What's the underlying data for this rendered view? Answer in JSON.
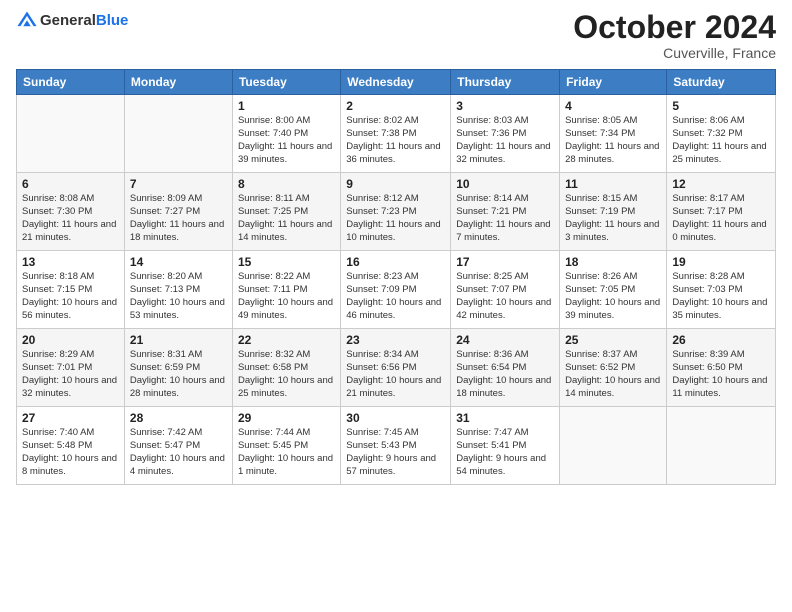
{
  "header": {
    "logo_general": "General",
    "logo_blue": "Blue",
    "month": "October 2024",
    "location": "Cuverville, France"
  },
  "columns": [
    "Sunday",
    "Monday",
    "Tuesday",
    "Wednesday",
    "Thursday",
    "Friday",
    "Saturday"
  ],
  "weeks": [
    [
      {
        "day": "",
        "sunrise": "",
        "sunset": "",
        "daylight": ""
      },
      {
        "day": "",
        "sunrise": "",
        "sunset": "",
        "daylight": ""
      },
      {
        "day": "1",
        "sunrise": "Sunrise: 8:00 AM",
        "sunset": "Sunset: 7:40 PM",
        "daylight": "Daylight: 11 hours and 39 minutes."
      },
      {
        "day": "2",
        "sunrise": "Sunrise: 8:02 AM",
        "sunset": "Sunset: 7:38 PM",
        "daylight": "Daylight: 11 hours and 36 minutes."
      },
      {
        "day": "3",
        "sunrise": "Sunrise: 8:03 AM",
        "sunset": "Sunset: 7:36 PM",
        "daylight": "Daylight: 11 hours and 32 minutes."
      },
      {
        "day": "4",
        "sunrise": "Sunrise: 8:05 AM",
        "sunset": "Sunset: 7:34 PM",
        "daylight": "Daylight: 11 hours and 28 minutes."
      },
      {
        "day": "5",
        "sunrise": "Sunrise: 8:06 AM",
        "sunset": "Sunset: 7:32 PM",
        "daylight": "Daylight: 11 hours and 25 minutes."
      }
    ],
    [
      {
        "day": "6",
        "sunrise": "Sunrise: 8:08 AM",
        "sunset": "Sunset: 7:30 PM",
        "daylight": "Daylight: 11 hours and 21 minutes."
      },
      {
        "day": "7",
        "sunrise": "Sunrise: 8:09 AM",
        "sunset": "Sunset: 7:27 PM",
        "daylight": "Daylight: 11 hours and 18 minutes."
      },
      {
        "day": "8",
        "sunrise": "Sunrise: 8:11 AM",
        "sunset": "Sunset: 7:25 PM",
        "daylight": "Daylight: 11 hours and 14 minutes."
      },
      {
        "day": "9",
        "sunrise": "Sunrise: 8:12 AM",
        "sunset": "Sunset: 7:23 PM",
        "daylight": "Daylight: 11 hours and 10 minutes."
      },
      {
        "day": "10",
        "sunrise": "Sunrise: 8:14 AM",
        "sunset": "Sunset: 7:21 PM",
        "daylight": "Daylight: 11 hours and 7 minutes."
      },
      {
        "day": "11",
        "sunrise": "Sunrise: 8:15 AM",
        "sunset": "Sunset: 7:19 PM",
        "daylight": "Daylight: 11 hours and 3 minutes."
      },
      {
        "day": "12",
        "sunrise": "Sunrise: 8:17 AM",
        "sunset": "Sunset: 7:17 PM",
        "daylight": "Daylight: 11 hours and 0 minutes."
      }
    ],
    [
      {
        "day": "13",
        "sunrise": "Sunrise: 8:18 AM",
        "sunset": "Sunset: 7:15 PM",
        "daylight": "Daylight: 10 hours and 56 minutes."
      },
      {
        "day": "14",
        "sunrise": "Sunrise: 8:20 AM",
        "sunset": "Sunset: 7:13 PM",
        "daylight": "Daylight: 10 hours and 53 minutes."
      },
      {
        "day": "15",
        "sunrise": "Sunrise: 8:22 AM",
        "sunset": "Sunset: 7:11 PM",
        "daylight": "Daylight: 10 hours and 49 minutes."
      },
      {
        "day": "16",
        "sunrise": "Sunrise: 8:23 AM",
        "sunset": "Sunset: 7:09 PM",
        "daylight": "Daylight: 10 hours and 46 minutes."
      },
      {
        "day": "17",
        "sunrise": "Sunrise: 8:25 AM",
        "sunset": "Sunset: 7:07 PM",
        "daylight": "Daylight: 10 hours and 42 minutes."
      },
      {
        "day": "18",
        "sunrise": "Sunrise: 8:26 AM",
        "sunset": "Sunset: 7:05 PM",
        "daylight": "Daylight: 10 hours and 39 minutes."
      },
      {
        "day": "19",
        "sunrise": "Sunrise: 8:28 AM",
        "sunset": "Sunset: 7:03 PM",
        "daylight": "Daylight: 10 hours and 35 minutes."
      }
    ],
    [
      {
        "day": "20",
        "sunrise": "Sunrise: 8:29 AM",
        "sunset": "Sunset: 7:01 PM",
        "daylight": "Daylight: 10 hours and 32 minutes."
      },
      {
        "day": "21",
        "sunrise": "Sunrise: 8:31 AM",
        "sunset": "Sunset: 6:59 PM",
        "daylight": "Daylight: 10 hours and 28 minutes."
      },
      {
        "day": "22",
        "sunrise": "Sunrise: 8:32 AM",
        "sunset": "Sunset: 6:58 PM",
        "daylight": "Daylight: 10 hours and 25 minutes."
      },
      {
        "day": "23",
        "sunrise": "Sunrise: 8:34 AM",
        "sunset": "Sunset: 6:56 PM",
        "daylight": "Daylight: 10 hours and 21 minutes."
      },
      {
        "day": "24",
        "sunrise": "Sunrise: 8:36 AM",
        "sunset": "Sunset: 6:54 PM",
        "daylight": "Daylight: 10 hours and 18 minutes."
      },
      {
        "day": "25",
        "sunrise": "Sunrise: 8:37 AM",
        "sunset": "Sunset: 6:52 PM",
        "daylight": "Daylight: 10 hours and 14 minutes."
      },
      {
        "day": "26",
        "sunrise": "Sunrise: 8:39 AM",
        "sunset": "Sunset: 6:50 PM",
        "daylight": "Daylight: 10 hours and 11 minutes."
      }
    ],
    [
      {
        "day": "27",
        "sunrise": "Sunrise: 7:40 AM",
        "sunset": "Sunset: 5:48 PM",
        "daylight": "Daylight: 10 hours and 8 minutes."
      },
      {
        "day": "28",
        "sunrise": "Sunrise: 7:42 AM",
        "sunset": "Sunset: 5:47 PM",
        "daylight": "Daylight: 10 hours and 4 minutes."
      },
      {
        "day": "29",
        "sunrise": "Sunrise: 7:44 AM",
        "sunset": "Sunset: 5:45 PM",
        "daylight": "Daylight: 10 hours and 1 minute."
      },
      {
        "day": "30",
        "sunrise": "Sunrise: 7:45 AM",
        "sunset": "Sunset: 5:43 PM",
        "daylight": "Daylight: 9 hours and 57 minutes."
      },
      {
        "day": "31",
        "sunrise": "Sunrise: 7:47 AM",
        "sunset": "Sunset: 5:41 PM",
        "daylight": "Daylight: 9 hours and 54 minutes."
      },
      {
        "day": "",
        "sunrise": "",
        "sunset": "",
        "daylight": ""
      },
      {
        "day": "",
        "sunrise": "",
        "sunset": "",
        "daylight": ""
      }
    ]
  ]
}
